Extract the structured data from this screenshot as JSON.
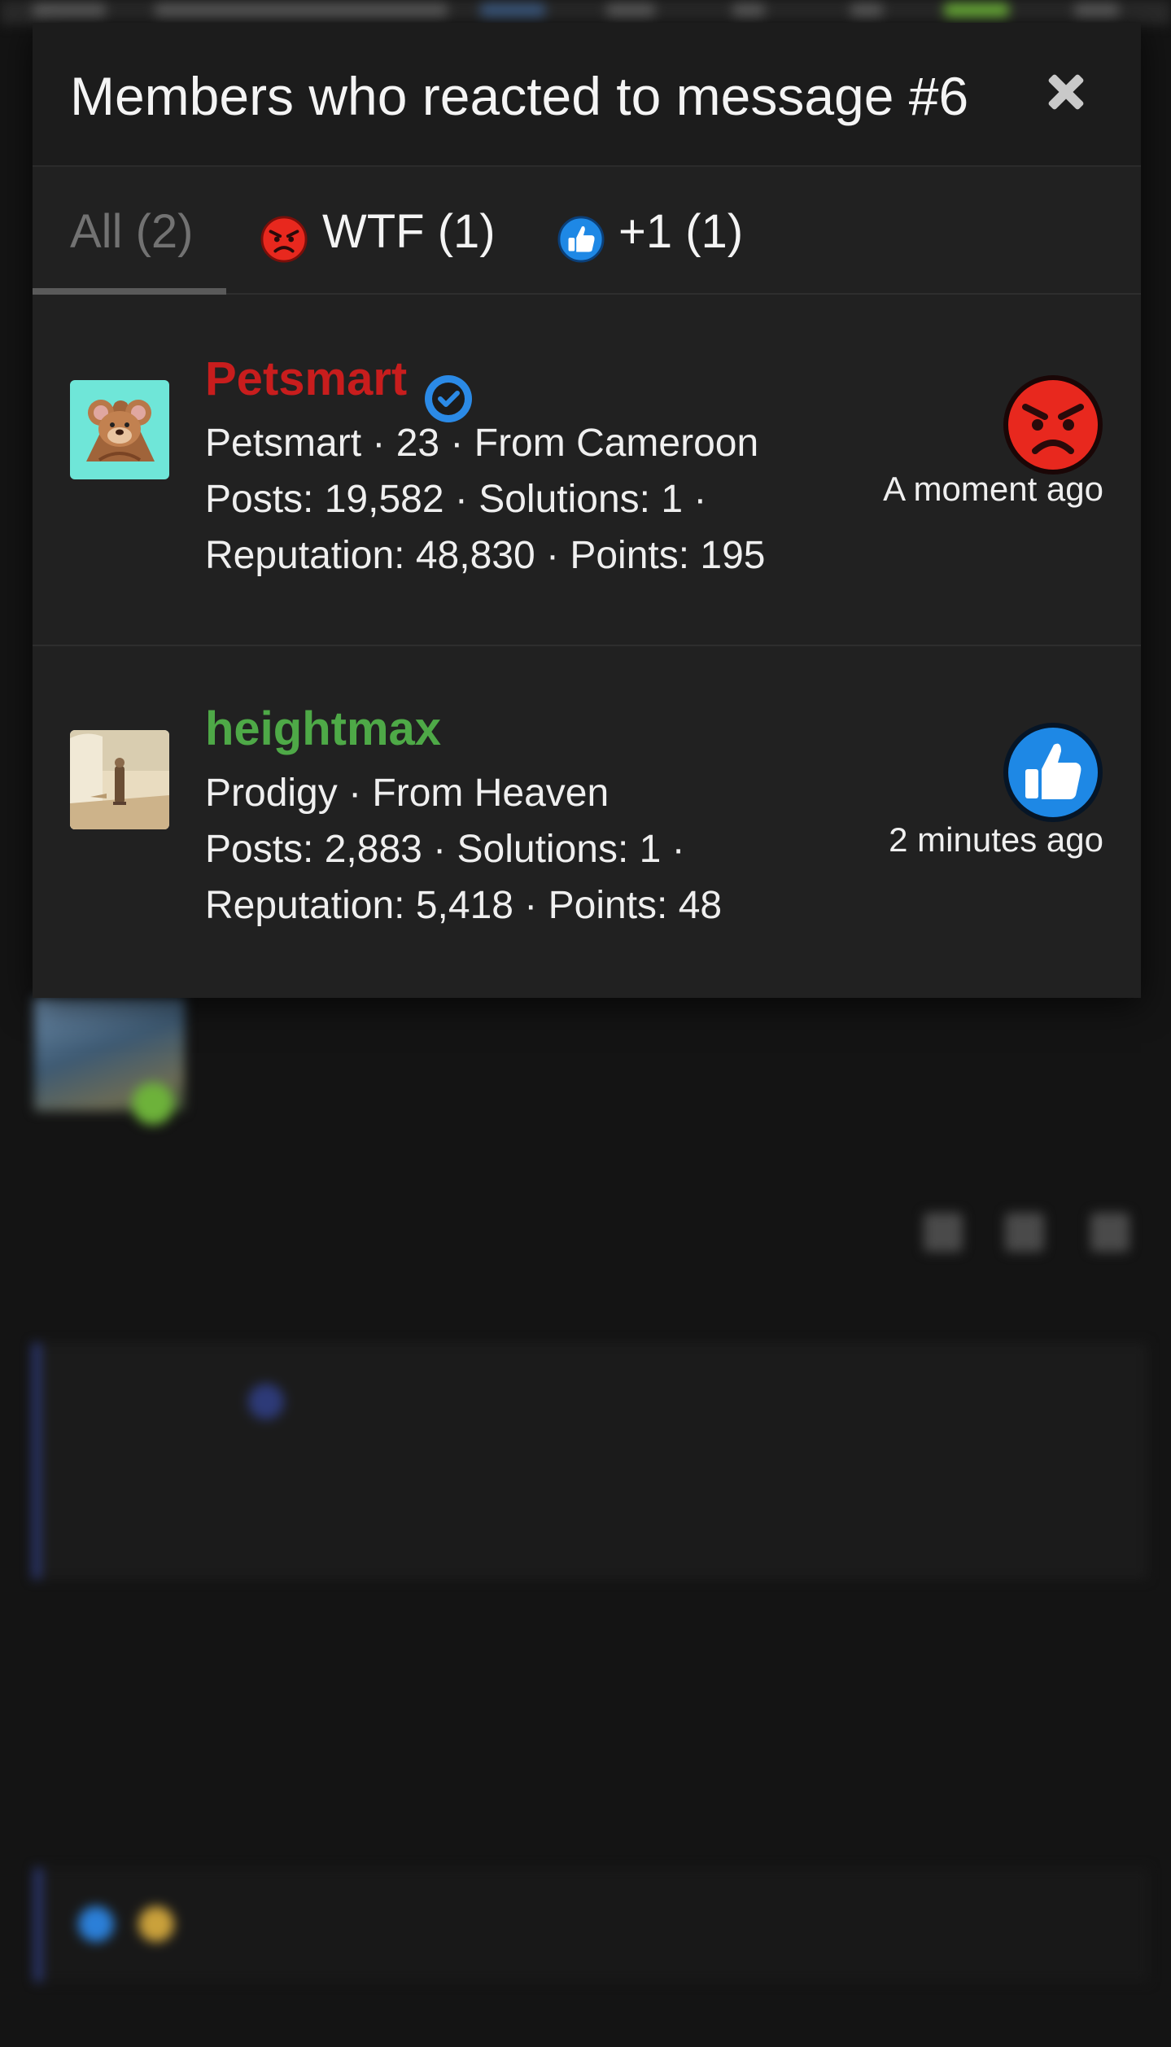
{
  "colors": {
    "background": "#141414",
    "modal_bg": "#212121",
    "header_bg": "#1c1c1c",
    "petsmart_name": "#c81d1d",
    "heightmax_name": "#4ea947",
    "wtf_red": "#e8281e",
    "like_blue": "#1e88e5",
    "verified_blue": "#2b8ae6"
  },
  "modal": {
    "title": "Members who reacted to message #6",
    "close_icon": "close-icon",
    "tabs": [
      {
        "label": "All (2)",
        "icon": ""
      },
      {
        "label": "WTF (1)",
        "icon": "angry-face-icon"
      },
      {
        "label": "+1 (1)",
        "icon": "thumbs-up-icon"
      }
    ],
    "members": [
      {
        "name": "Petsmart",
        "verified": true,
        "meta_line1": "Petsmart · 23 · From Cameroon",
        "meta_line2": "Posts: 19,582 · Solutions: 1 ·",
        "meta_line3": "Reputation: 48,830 · Points: 195",
        "reaction_icon": "angry-face-icon",
        "time": "A moment ago"
      },
      {
        "name": "heightmax",
        "verified": false,
        "meta_line1": "Prodigy · From Heaven",
        "meta_line2": "Posts: 2,883 · Solutions: 1 ·",
        "meta_line3": "Reputation: 5,418 · Points: 48",
        "reaction_icon": "thumbs-up-icon",
        "time": "2 minutes ago"
      }
    ]
  }
}
